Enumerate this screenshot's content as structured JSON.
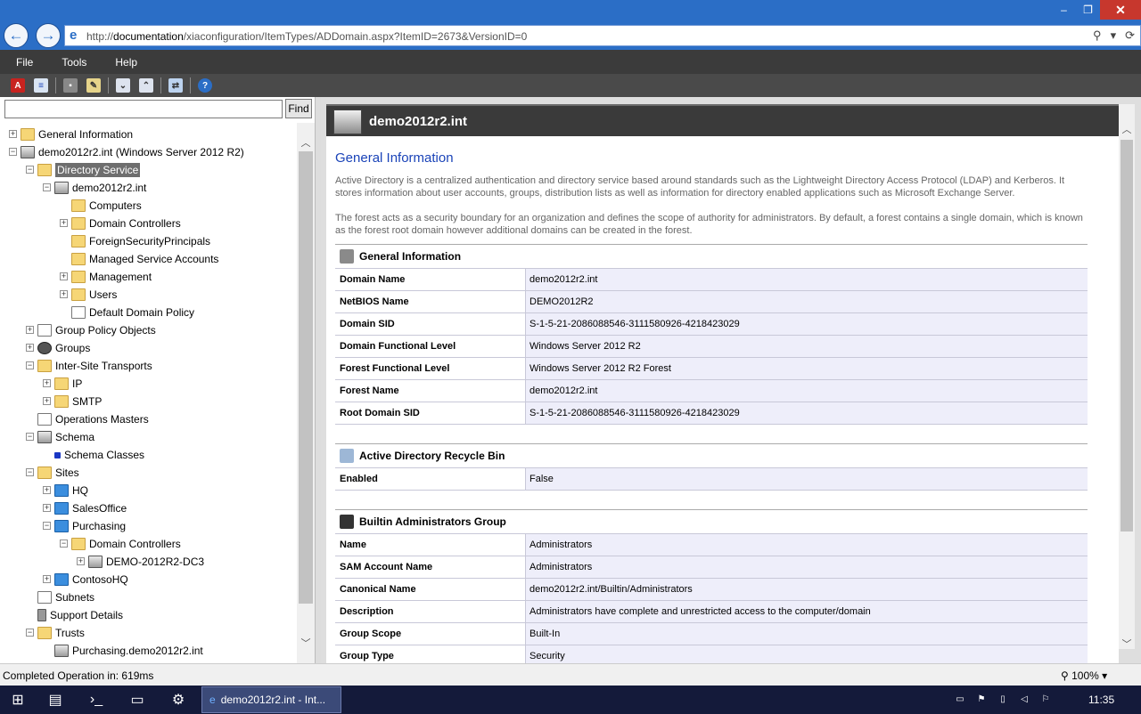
{
  "browser": {
    "url_prefix": "http://",
    "url_host": "documentation",
    "url_path": "/xiaconfiguration/ItemTypes/ADDomain.aspx?ItemID=2673&VersionID=0",
    "window_buttons": [
      "–",
      "❐",
      "✕"
    ]
  },
  "menu": [
    "File",
    "Tools",
    "Help"
  ],
  "toolbar_icons": [
    "pdf-icon",
    "export-icon",
    "save-icon",
    "edit-icon",
    "expand-all-icon",
    "collapse-all-icon",
    "compare-icon",
    "help-icon"
  ],
  "left": {
    "search_placeholder": "",
    "find_label": "Find",
    "tree": [
      {
        "label": "General Information",
        "level": 0,
        "icon": "folder",
        "exp": "+"
      },
      {
        "label": "demo2012r2.int (Windows Server 2012 R2)",
        "level": 0,
        "icon": "server",
        "exp": "−"
      },
      {
        "label": "Directory Service",
        "level": 1,
        "icon": "folder",
        "exp": "−",
        "selected": true
      },
      {
        "label": "demo2012r2.int",
        "level": 2,
        "icon": "server",
        "exp": "−"
      },
      {
        "label": "Computers",
        "level": 3,
        "icon": "folder",
        "exp": ""
      },
      {
        "label": "Domain Controllers",
        "level": 3,
        "icon": "folder",
        "exp": "+"
      },
      {
        "label": "ForeignSecurityPrincipals",
        "level": 3,
        "icon": "folder",
        "exp": ""
      },
      {
        "label": "Managed Service Accounts",
        "level": 3,
        "icon": "folder",
        "exp": ""
      },
      {
        "label": "Management",
        "level": 3,
        "icon": "folder",
        "exp": "+"
      },
      {
        "label": "Users",
        "level": 3,
        "icon": "folder",
        "exp": "+"
      },
      {
        "label": "Default Domain Policy",
        "level": 3,
        "icon": "doc",
        "exp": ""
      },
      {
        "label": "Group Policy Objects",
        "level": 1,
        "icon": "doc",
        "exp": "+"
      },
      {
        "label": "Groups",
        "level": 1,
        "icon": "group",
        "exp": "+"
      },
      {
        "label": "Inter-Site Transports",
        "level": 1,
        "icon": "folder",
        "exp": "−"
      },
      {
        "label": "IP",
        "level": 2,
        "icon": "folder",
        "exp": "+"
      },
      {
        "label": "SMTP",
        "level": 2,
        "icon": "folder",
        "exp": "+"
      },
      {
        "label": "Operations Masters",
        "level": 1,
        "icon": "doc",
        "exp": ""
      },
      {
        "label": "Schema",
        "level": 1,
        "icon": "server",
        "exp": "−"
      },
      {
        "label": "Schema Classes",
        "level": 2,
        "icon": "schema",
        "exp": ""
      },
      {
        "label": "Sites",
        "level": 1,
        "icon": "folder",
        "exp": "−"
      },
      {
        "label": "HQ",
        "level": 2,
        "icon": "site",
        "exp": "+"
      },
      {
        "label": "SalesOffice",
        "level": 2,
        "icon": "site",
        "exp": "+"
      },
      {
        "label": "Purchasing",
        "level": 2,
        "icon": "site",
        "exp": "−"
      },
      {
        "label": "Domain Controllers",
        "level": 3,
        "icon": "folder",
        "exp": "−"
      },
      {
        "label": "DEMO-2012R2-DC3",
        "level": 4,
        "icon": "server",
        "exp": "+"
      },
      {
        "label": "ContosoHQ",
        "level": 2,
        "icon": "site",
        "exp": "+"
      },
      {
        "label": "Subnets",
        "level": 1,
        "icon": "doc",
        "exp": ""
      },
      {
        "label": "Support Details",
        "level": 1,
        "icon": "db",
        "exp": ""
      },
      {
        "label": "Trusts",
        "level": 1,
        "icon": "folder",
        "exp": "−"
      },
      {
        "label": "Purchasing.demo2012r2.int",
        "level": 2,
        "icon": "server",
        "exp": ""
      }
    ]
  },
  "right": {
    "header_title": "demo2012r2.int",
    "section_title": "General Information",
    "para1": "Active Directory is a centralized authentication and directory service based around standards such as the Lightweight Directory Access Protocol (LDAP) and Kerberos. It stores information about user accounts, groups, distribution lists as well as information for directory enabled applications such as Microsoft Exchange Server.",
    "para2": "The forest acts as a security boundary for an organization and defines the scope of authority for administrators. By default, a forest contains a single domain, which is known as the forest root domain however additional domains can be created in the forest.",
    "tables": [
      {
        "title": "General Information",
        "icon": "server-icon",
        "rows": [
          [
            "Domain Name",
            "demo2012r2.int"
          ],
          [
            "NetBIOS Name",
            "DEMO2012R2"
          ],
          [
            "Domain SID",
            "S-1-5-21-2086088546-3111580926-4218423029"
          ],
          [
            "Domain Functional Level",
            "Windows Server 2012 R2"
          ],
          [
            "Forest Functional Level",
            "Windows Server 2012 R2 Forest"
          ],
          [
            "Forest Name",
            "demo2012r2.int"
          ],
          [
            "Root Domain SID",
            "S-1-5-21-2086088546-3111580926-4218423029"
          ]
        ]
      },
      {
        "title": "Active Directory Recycle Bin",
        "icon": "recycle-bin-icon",
        "rows": [
          [
            "Enabled",
            "False"
          ]
        ]
      },
      {
        "title": "Builtin Administrators Group",
        "icon": "group-icon",
        "rows": [
          [
            "Name",
            "Administrators"
          ],
          [
            "SAM Account Name",
            "Administrators"
          ],
          [
            "Canonical Name",
            "demo2012r2.int/Builtin/Administrators"
          ],
          [
            "Description",
            "Administrators have complete and unrestricted access to the computer/domain"
          ],
          [
            "Group Scope",
            "Built-In"
          ],
          [
            "Group Type",
            "Security"
          ]
        ]
      }
    ]
  },
  "status": {
    "text": "Completed Operation in: 619ms",
    "zoom": "100%"
  },
  "taskbar": {
    "active_window": "demo2012r2.int - Int...",
    "clock": "11:35"
  },
  "colors": {
    "accent": "#2b6ec6",
    "section_title": "#1a43b8",
    "value_bg": "#eeeefa"
  }
}
